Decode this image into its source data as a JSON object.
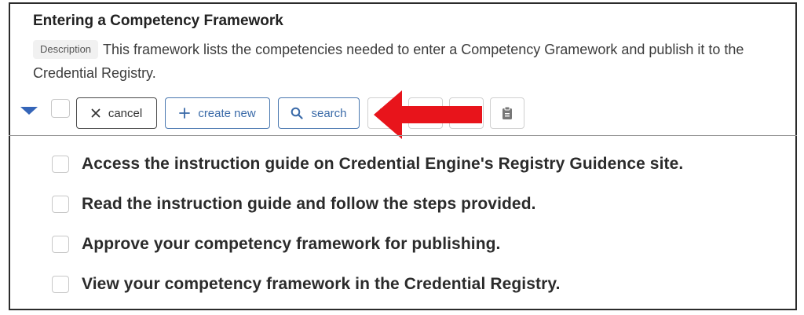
{
  "framework": {
    "title": "Entering a Competency Framework",
    "description_tag": "Description",
    "description_text": "This framework lists the competencies needed to enter a Competency Gramework and publish it to the Credential Registry."
  },
  "toolbar": {
    "cancel_label": "cancel",
    "create_label": "create new",
    "search_label": "search"
  },
  "competencies": [
    {
      "label": "Access the instruction guide on Credential Engine's Registry Guidence site."
    },
    {
      "label": "Read the instruction guide and follow the steps provided."
    },
    {
      "label": "Approve your competency framework for publishing."
    },
    {
      "label": "View your competency framework in the Credential Registry."
    }
  ],
  "colors": {
    "accent_blue": "#3a6aa8",
    "caret_blue": "#3565b8",
    "annotation_arrow": "#e8141b"
  },
  "icons": {
    "caret": "caret-down-icon",
    "cancel": "x-icon",
    "create": "plus-icon",
    "search": "magnifier-icon",
    "paste": "clipboard-icon"
  }
}
